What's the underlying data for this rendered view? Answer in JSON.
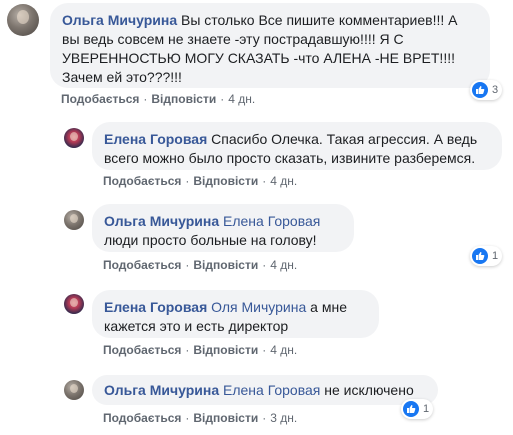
{
  "actions": {
    "like": "Подобається",
    "reply": "Відповісти",
    "dot": "·"
  },
  "comments": [
    {
      "author": "Ольга Мичурина",
      "mention": "",
      "text": "Вы столько Все пишите комментариев!!! А вы ведь совсем не знаете -эту пострадавшую!!!! Я С УВЕРЕННОСТЬЮ МОГУ СКАЗАТЬ -что АЛЕНА -НЕ ВРЕТ!!!! Зачем ей это???!!!",
      "time": "4 дн.",
      "reactions": "3"
    },
    {
      "author": "Елена Горовая",
      "mention": "",
      "text": "Спасибо Олечка. Такая агрессия. А ведь всего можно было просто сказать, извините разберемся.",
      "time": "4 дн.",
      "reactions": ""
    },
    {
      "author": "Ольга Мичурина",
      "mention": "Елена Горовая",
      "text": "люди просто больные на голову!",
      "time": "4 дн.",
      "reactions": "1"
    },
    {
      "author": "Елена Горовая",
      "mention": "Оля Мичурина",
      "text": "а мне кажется это и есть директор",
      "time": "4 дн.",
      "reactions": ""
    },
    {
      "author": "Ольга Мичурина",
      "mention": "Елена Горовая",
      "text": "не исключено",
      "time": "3 дн.",
      "reactions": "1"
    }
  ],
  "colors": {
    "link": "#385898",
    "bubble": "#f2f3f5",
    "like": "#1877f2",
    "meta": "#606770"
  }
}
